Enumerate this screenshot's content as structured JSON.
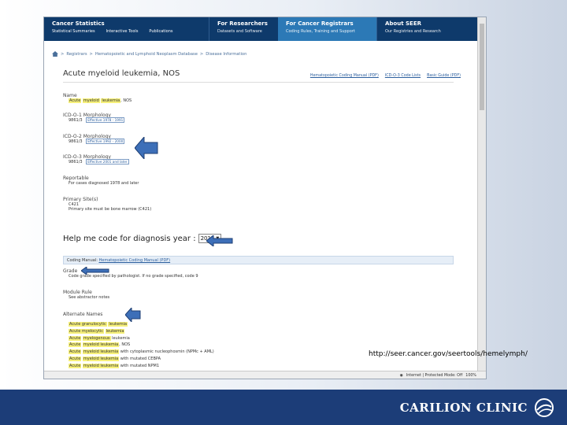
{
  "nav": {
    "cancer_stats": {
      "title": "Cancer Statistics",
      "links": [
        "Statistical Summaries",
        "Interactive Tools",
        "Publications"
      ]
    },
    "researchers": {
      "title": "For Researchers",
      "sub": "Datasets and Software"
    },
    "registrars": {
      "title": "For Cancer Registrars",
      "sub": "Coding Rules, Training and Support"
    },
    "about": {
      "title": "About SEER",
      "sub": "Our Registries and Research"
    }
  },
  "breadcrumb": [
    "Registrars",
    "Hematopoietic and Lymphoid Neoplasm Database",
    "Disease Information"
  ],
  "page": {
    "title": "Acute myeloid leukemia, NOS",
    "top_links": [
      "Hematopoietic Coding Manual (PDF)",
      "ICD-O-3 Code Lists",
      "Basic Guide (PDF)"
    ]
  },
  "fields": {
    "name": {
      "label": "Name",
      "value_prefix": "Acute",
      "hl1": "myeloid",
      "hl2": "leukemia",
      "value_suffix": ", NOS"
    },
    "icdo1": {
      "label": "ICD-O-1 Morphology",
      "code": "9861/3",
      "effective": "Effective 1978 - 1991"
    },
    "icdo2": {
      "label": "ICD-O-2 Morphology",
      "code": "9861/3",
      "effective": "Effective 1992 - 2000"
    },
    "icdo3": {
      "label": "ICD-O-3 Morphology",
      "code": "9861/3",
      "effective": "Effective 2001 and later"
    },
    "reportable": {
      "label": "Reportable",
      "value": "For cases diagnosed 1978 and later"
    },
    "primary_site": {
      "label": "Primary Site(s)",
      "value1": "C421",
      "value2": "Primary site must be bone marrow (C421)"
    }
  },
  "help": {
    "label": "Help me code for diagnosis year :",
    "year": "2015"
  },
  "coding": {
    "label": "Coding Manual:",
    "link": "Hematopoietic Coding Manual (PDF)"
  },
  "grade": {
    "label": "Grade",
    "value": "Code grade specified by pathologist. If no grade specified, code 9"
  },
  "module": {
    "label": "Module Rule",
    "value": "See abstractor notes"
  },
  "alternate": {
    "label": "Alternate Names",
    "items": [
      {
        "pre": "Acute granulocytic",
        "hl": "leukemia",
        "post": ""
      },
      {
        "pre": "Acute myelocytic",
        "hl": "leukemia",
        "post": ""
      },
      {
        "pre": "Acute",
        "hl": "myelogenous",
        "post": " leukemia"
      },
      {
        "pre": "Acute",
        "hl": "myeloid leukemia",
        "post": ", NOS"
      },
      {
        "pre": "Acute",
        "hl": "myeloid leukemia",
        "post": " with cytoplasmic nucleophosmin (NPMc + AML)"
      },
      {
        "pre": "Acute",
        "hl": "myeloid leukemia",
        "post": " with mutated CEBPA"
      },
      {
        "pre": "Acute",
        "hl": "myeloid leukemia",
        "post": " with mutated NPM1"
      }
    ]
  },
  "status": {
    "zone": "Internet | Protected Mode: Off",
    "zoom": "100%"
  },
  "url_label": "http://seer.cancer.gov/seertools/hemelymph/",
  "footer": {
    "logo": "CARILION CLINIC"
  },
  "colors": {
    "nav": "#0e3a6b",
    "nav_active": "#2c79b6",
    "footer": "#1c3d78",
    "highlight": "#f6f07a",
    "arrow": "#3d6fb8"
  }
}
